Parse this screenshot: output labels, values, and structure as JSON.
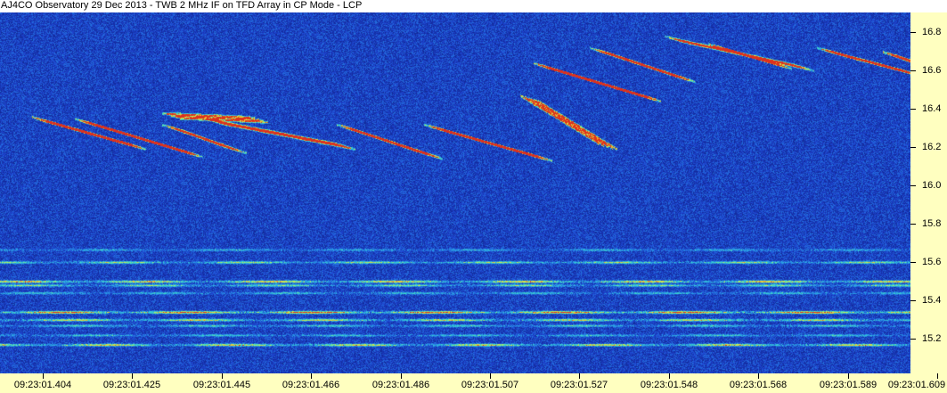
{
  "title": "AJ4CO Observatory 29 Dec 2013 - TWB 2 MHz IF on TFD Array in CP Mode - LCP",
  "colors": {
    "plot_background": "#1a3fb8",
    "axis_panel": "#ffffc0",
    "signal_cyan": "#40e0e0",
    "signal_yellow": "#f0f040",
    "signal_red": "#e04020"
  },
  "chart_data": {
    "type": "heatmap",
    "xlabel": "",
    "ylabel": "",
    "x_ticks": [
      "09:23:01.404",
      "09:23:01.425",
      "09:23:01.445",
      "09:23:01.466",
      "09:23:01.486",
      "09:23:01.507",
      "09:23:01.527",
      "09:23:01.548",
      "09:23:01.568",
      "09:23:01.589",
      "09:23:01.609"
    ],
    "x_range": [
      "09:23:01.404",
      "09:23:01.609"
    ],
    "y_ticks": [
      "16.8",
      "16.6",
      "16.4",
      "16.2",
      "16.0",
      "15.8",
      "15.6",
      "15.4",
      "15.2"
    ],
    "y_range": [
      15.02,
      16.9
    ],
    "grid": false,
    "legend": "none",
    "bursts": [
      {
        "t_start": 0.0,
        "t_end": 0.022,
        "f_start": 16.34,
        "f_end": 16.2,
        "intensity": 0.55
      },
      {
        "t_start": 0.01,
        "t_end": 0.035,
        "f_start": 16.33,
        "f_end": 16.16,
        "intensity": 0.5
      },
      {
        "t_start": 0.03,
        "t_end": 0.045,
        "f_start": 16.3,
        "f_end": 16.18,
        "intensity": 0.45
      },
      {
        "t_start": 0.03,
        "t_end": 0.05,
        "f_start": 16.36,
        "f_end": 16.34,
        "intensity": 0.7
      },
      {
        "t_start": 0.04,
        "t_end": 0.07,
        "f_start": 16.33,
        "f_end": 16.2,
        "intensity": 0.55
      },
      {
        "t_start": 0.07,
        "t_end": 0.09,
        "f_start": 16.3,
        "f_end": 16.15,
        "intensity": 0.5
      },
      {
        "t_start": 0.09,
        "t_end": 0.115,
        "f_start": 16.3,
        "f_end": 16.14,
        "intensity": 0.5
      },
      {
        "t_start": 0.112,
        "t_end": 0.13,
        "f_start": 16.45,
        "f_end": 16.2,
        "intensity": 0.85
      },
      {
        "t_start": 0.115,
        "t_end": 0.14,
        "f_start": 16.62,
        "f_end": 16.45,
        "intensity": 0.6
      },
      {
        "t_start": 0.128,
        "t_end": 0.148,
        "f_start": 16.7,
        "f_end": 16.55,
        "intensity": 0.45
      },
      {
        "t_start": 0.145,
        "t_end": 0.175,
        "f_start": 16.76,
        "f_end": 16.61,
        "intensity": 0.4
      },
      {
        "t_start": 0.155,
        "t_end": 0.17,
        "f_start": 16.72,
        "f_end": 16.62,
        "intensity": 0.45
      },
      {
        "t_start": 0.18,
        "t_end": 0.2,
        "f_start": 16.7,
        "f_end": 16.58,
        "intensity": 0.45
      },
      {
        "t_start": 0.195,
        "t_end": 0.205,
        "f_start": 16.68,
        "f_end": 16.6,
        "intensity": 0.6
      }
    ],
    "bands": [
      {
        "f": 15.665,
        "intensity": 0.3
      },
      {
        "f": 15.6,
        "intensity": 0.55
      },
      {
        "f": 15.5,
        "intensity": 0.75
      },
      {
        "f": 15.48,
        "intensity": 0.5
      },
      {
        "f": 15.44,
        "intensity": 0.35
      },
      {
        "f": 15.34,
        "intensity": 0.95
      },
      {
        "f": 15.3,
        "intensity": 0.65
      },
      {
        "f": 15.27,
        "intensity": 0.4
      },
      {
        "f": 15.22,
        "intensity": 0.35
      },
      {
        "f": 15.17,
        "intensity": 0.7
      }
    ]
  }
}
